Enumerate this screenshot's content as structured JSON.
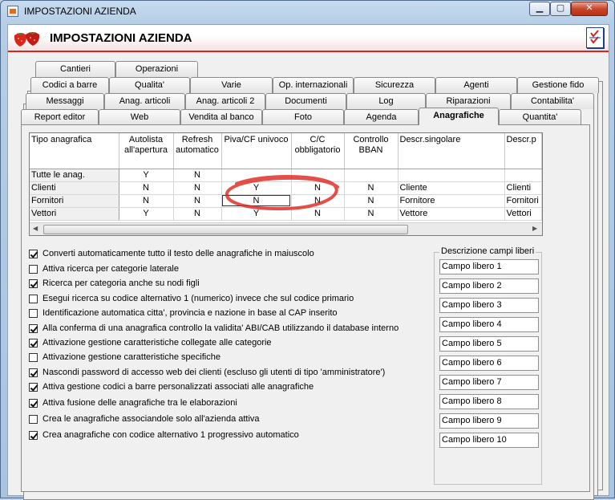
{
  "window": {
    "title": "IMPOSTAZIONI AZIENDA",
    "min_label": "▁",
    "max_label": "▢",
    "close_label": "✕"
  },
  "banner": {
    "title": "IMPOSTAZIONI AZIENDA",
    "logo_icon": "strawberry-icon",
    "check_icon": "checklist-icon",
    "accent": "#d9251c"
  },
  "tabs": {
    "row1": [
      "Cantieri",
      "Operazioni"
    ],
    "row2": [
      "Codici a barre",
      "Qualita'",
      "Varie",
      "Op. internazionali",
      "Sicurezza",
      "Agenti",
      "Gestione fido"
    ],
    "row3": [
      "Messaggi",
      "Anag. articoli",
      "Anag. articoli 2",
      "Documenti",
      "Log",
      "Riparazioni",
      "Contabilita'"
    ],
    "row4": [
      "Report editor",
      "Web",
      "Vendita al banco",
      "Foto",
      "Agenda",
      "Anagrafiche",
      "Quantita'"
    ],
    "active": "Anagrafiche"
  },
  "grid": {
    "headers": [
      "Tipo anagrafica",
      "Autolista all'apertura",
      "Refresh automatico",
      "Piva/CF univoco",
      "C/C obbligatorio",
      "Controllo BBAN",
      "Descr.singolare",
      "Descr.p"
    ],
    "rows": [
      [
        "Tutte le anag.",
        "Y",
        "N",
        "",
        "",
        "",
        "",
        ""
      ],
      [
        "Clienti",
        "N",
        "N",
        "Y",
        "N",
        "N",
        "Cliente",
        "Clienti"
      ],
      [
        "Fornitori",
        "N",
        "N",
        "N",
        "N",
        "N",
        "Fornitore",
        "Fornitori"
      ],
      [
        "Vettori",
        "Y",
        "N",
        "Y",
        "N",
        "N",
        "Vettore",
        "Vettori"
      ]
    ]
  },
  "options": [
    {
      "label": "Converti automaticamente tutto il testo delle anagrafiche in maiuscolo",
      "checked": true
    },
    {
      "label": "Attiva ricerca per categorie laterale",
      "checked": false
    },
    {
      "label": "Ricerca per categoria anche su nodi figli",
      "checked": true
    },
    {
      "label": "Esegui ricerca su codice alternativo 1 (numerico) invece che sul codice primario",
      "checked": false
    },
    {
      "label": "Identificazione automatica citta', provincia e nazione in base al CAP inserito",
      "checked": false
    },
    {
      "label": "Alla conferma di una anagrafica controllo la validita' ABI/CAB utilizzando il database interno",
      "checked": true
    },
    {
      "label": "Attivazione gestione caratteristiche collegate alle categorie",
      "checked": true
    },
    {
      "label": "Attivazione gestione caratteristiche specifiche",
      "checked": false
    },
    {
      "label": "Nascondi password di accesso web dei clienti (escluso gli utenti di tipo 'amministratore')",
      "checked": true
    },
    {
      "label": "Attiva gestione codici a barre personalizzati associati alle anagrafiche",
      "checked": true
    },
    {
      "label": "Attiva fusione delle anagrafiche tra le elaborazioni",
      "checked": true
    },
    {
      "label": "Crea le anagrafiche associandole solo all'azienda attiva",
      "checked": false
    },
    {
      "label": "Crea anagrafiche con codice alternativo 1 progressivo automatico",
      "checked": true
    }
  ],
  "free_fields": {
    "legend": "Descrizione campi liberi",
    "values": [
      "Campo libero 1",
      "Campo libero 2",
      "Campo libero 3",
      "Campo libero 4",
      "Campo libero 5",
      "Campo libero 6",
      "Campo libero 7",
      "Campo libero 8",
      "Campo libero 9",
      "Campo libero 10"
    ]
  }
}
